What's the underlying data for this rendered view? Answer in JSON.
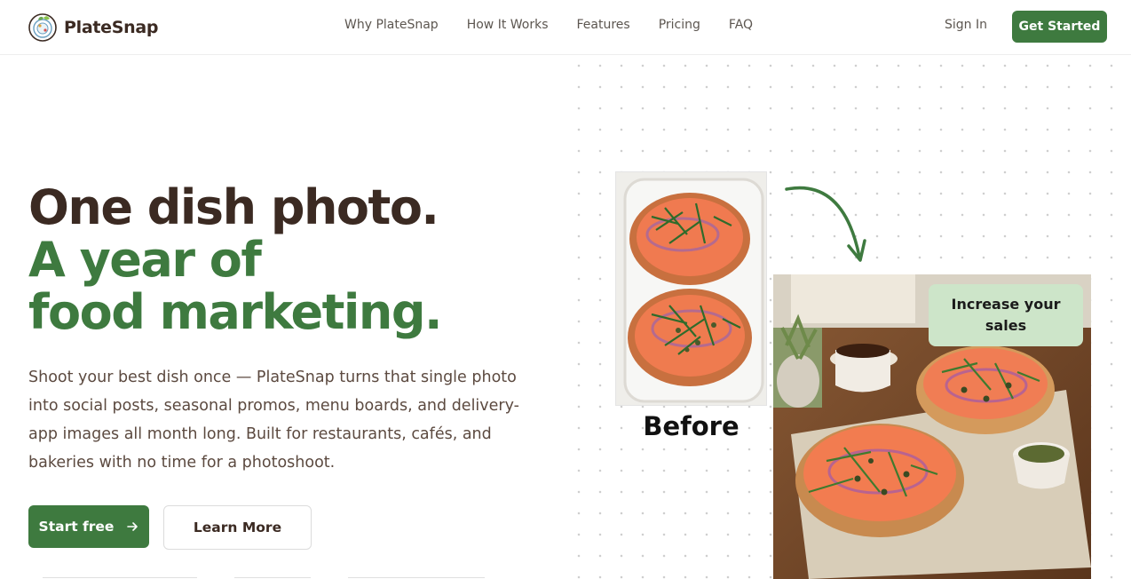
{
  "brand": {
    "name": "PlateSnap",
    "accent": "#3e7a3f",
    "dark": "#3b2a22"
  },
  "nav": {
    "items": [
      "Why PlateSnap",
      "How It Works",
      "Features",
      "Pricing",
      "FAQ"
    ],
    "sign_in": "Sign In",
    "cta": "Get Started"
  },
  "hero": {
    "headline_line1": "One dish photo.",
    "headline_line2": "A year of",
    "headline_line3": "food marketing.",
    "lead": "Shoot your best dish once — PlateSnap turns that single photo into social posts, seasonal promos, menu boards, and delivery-app images all month long. Built for restaurants, cafés, and bakeries with no time for a photoshoot.",
    "primary_button": "Start free",
    "primary_icon": "arrow-right-icon",
    "secondary_button": "Learn More"
  },
  "showcase": {
    "before_label": "Before",
    "badge": "Increase your sales",
    "arrow_icon": "curved-arrow-icon"
  }
}
